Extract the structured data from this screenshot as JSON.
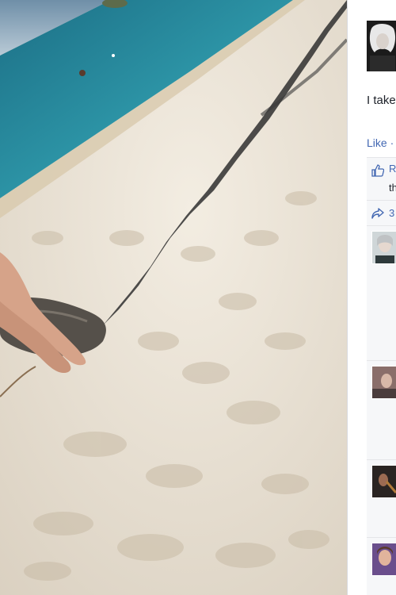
{
  "post": {
    "caption_fragment": "I take",
    "like_link_fragment": "Like ·"
  },
  "reactions": {
    "label_fragment": "R",
    "second_line_fragment": "th"
  },
  "shares": {
    "count_fragment": "3"
  },
  "comments": [
    {
      "avatar_desc": "commenter-1"
    },
    {
      "avatar_desc": "commenter-2"
    },
    {
      "avatar_desc": "commenter-3"
    },
    {
      "avatar_desc": "commenter-4"
    }
  ],
  "colors": {
    "link": "#4267b2",
    "panel_bg": "#ffffff",
    "comment_bg": "#f6f7f9",
    "sand": "#ece4d6",
    "sea": "#2f8ea0",
    "shadow": "#3a3a3a"
  },
  "icons": [
    "thumbs-up-icon",
    "share-arrow-icon"
  ]
}
